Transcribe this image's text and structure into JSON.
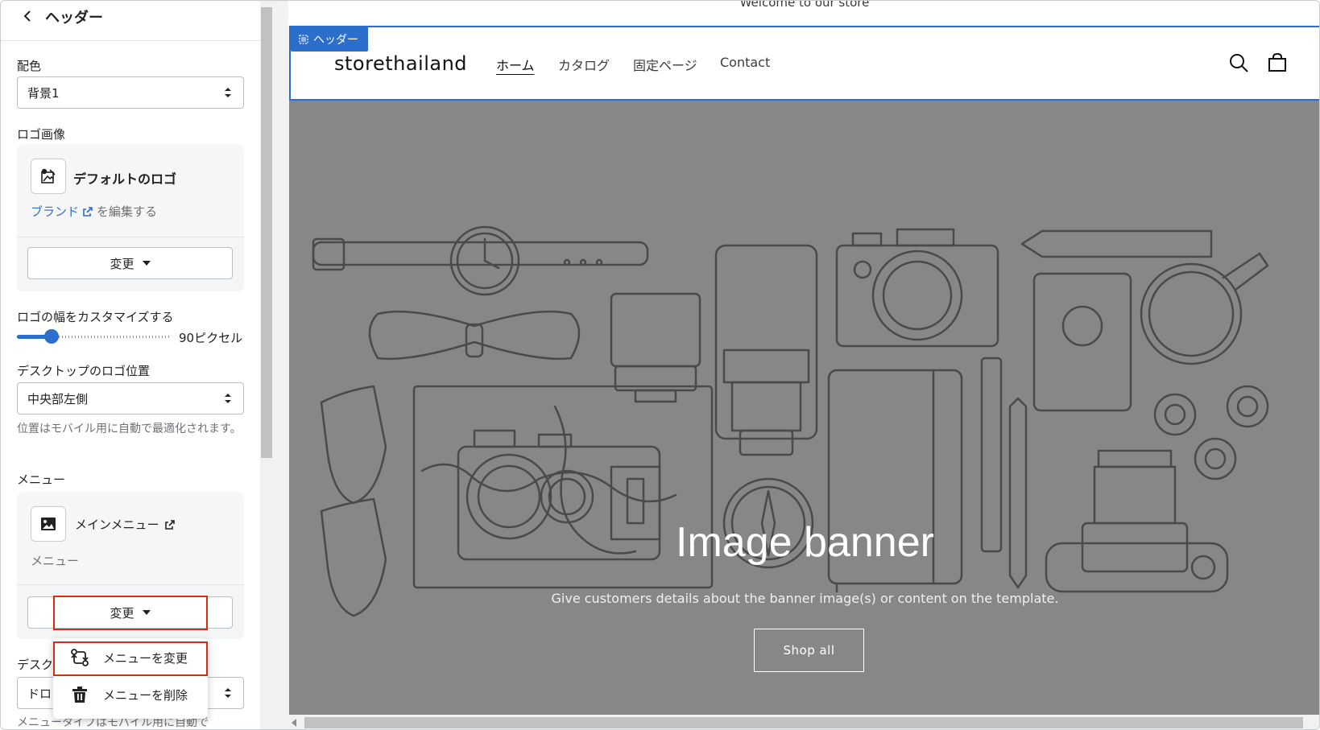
{
  "sidebar": {
    "title": "ヘッダー",
    "color_scheme": {
      "label": "配色",
      "value": "背景1"
    },
    "logo_image": {
      "label": "ロゴ画像",
      "name": "デフォルトのロゴ",
      "brand_link": "ブランド",
      "brand_suffix": "を編集する",
      "change_label": "変更"
    },
    "logo_width": {
      "label": "ロゴの幅をカスタマイズする",
      "value_text": "90ピクセル",
      "fraction": 0.19
    },
    "desktop_logo_position": {
      "label": "デスクトップのロゴ位置",
      "value": "中央部左側",
      "help": "位置はモバイル用に自動で最適化されます。"
    },
    "menu": {
      "label": "メニュー",
      "name": "メインメニュー",
      "subtitle": "メニュー",
      "change_label": "変更",
      "dropdown": {
        "change_menu": "メニューを変更",
        "delete_menu": "メニューを削除"
      }
    },
    "desktop_menu_type": {
      "label_partial": "デスク",
      "value_partial": "ドロ",
      "help_partial": "メニュータイプはモバイル用に自動で"
    }
  },
  "preview": {
    "announcement": "Welcome to our store",
    "header_tag": "ヘッダー",
    "store_name": "storethailand",
    "nav": [
      "ホーム",
      "カタログ",
      "固定ページ",
      "Contact"
    ],
    "banner": {
      "title": "Image banner",
      "text": "Give customers details about the banner image(s) or content on the template.",
      "button": "Shop all"
    }
  },
  "colors": {
    "accent": "#2c6ecb",
    "highlight": "#d72c0d",
    "banner_bg": "#878787"
  }
}
